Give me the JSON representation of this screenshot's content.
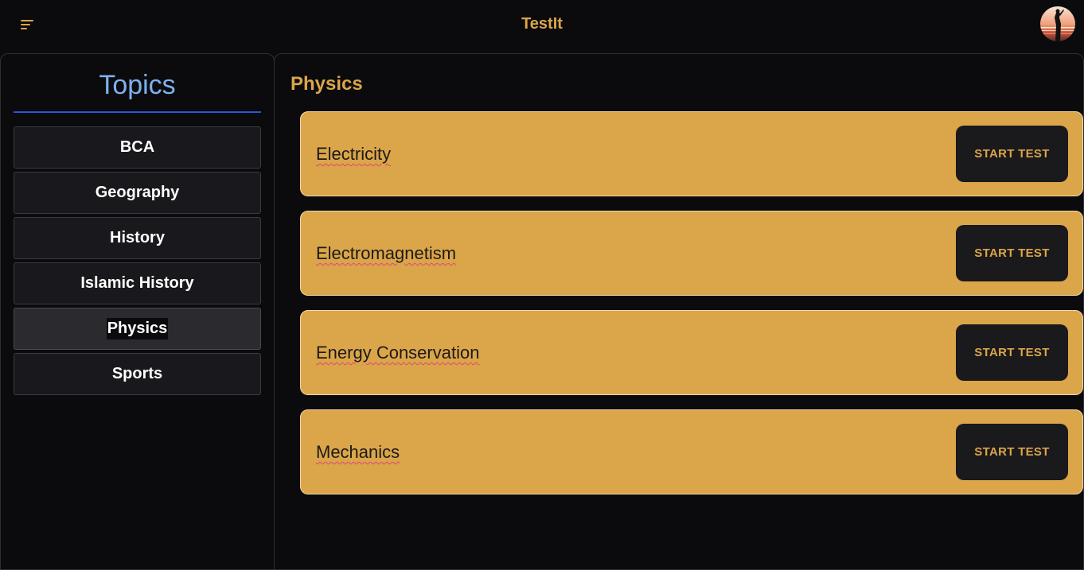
{
  "app": {
    "title": "TestIt",
    "accent_color": "#dba54a",
    "menu_icon": "menu-icon",
    "avatar_icon": "user-avatar"
  },
  "sidebar": {
    "title": "Topics",
    "title_color": "#7fb0ef",
    "underline_color": "#2b55d8",
    "items": [
      {
        "label": "BCA",
        "active": false
      },
      {
        "label": "Geography",
        "active": false
      },
      {
        "label": "History",
        "active": false
      },
      {
        "label": "Islamic History",
        "active": false
      },
      {
        "label": "Physics",
        "active": true
      },
      {
        "label": "Sports",
        "active": false
      }
    ]
  },
  "main": {
    "title": "Physics",
    "card_color": "#dba54a",
    "cards": [
      {
        "label": "Electricity",
        "button": "START TEST"
      },
      {
        "label": "Electromagnetism",
        "button": "START TEST"
      },
      {
        "label": "Energy Conservation",
        "button": "START TEST"
      },
      {
        "label": "Mechanics",
        "button": "START TEST"
      }
    ]
  }
}
